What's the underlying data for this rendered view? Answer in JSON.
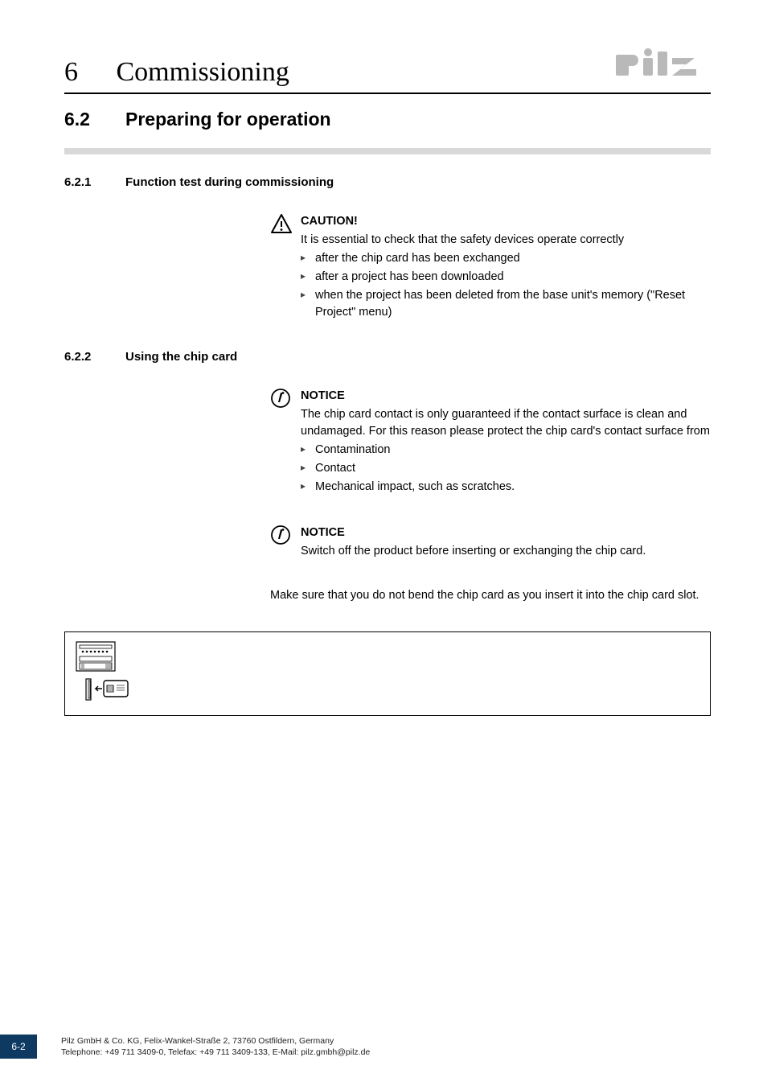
{
  "header": {
    "chapter_number": "6",
    "chapter_title": "Commissioning"
  },
  "h2": {
    "num": "6.2",
    "title": "Preparing for operation"
  },
  "sections": {
    "s1": {
      "num": "6.2.1",
      "title": "Function test during commissioning",
      "caution_label": "CAUTION!",
      "caution_intro": "It is essential to check that the safety devices operate correctly",
      "caution_items": {
        "a": "after the chip card has been exchanged",
        "b": "after a project has been downloaded",
        "c": "when the project has been deleted from the base unit's memory (\"Reset Project\" menu)"
      }
    },
    "s2": {
      "num": "6.2.2",
      "title": "Using the chip card",
      "notice1_label": "NOTICE",
      "notice1_text": "The chip card contact is only guaranteed if the contact surface is clean and undamaged. For this reason please protect the chip card's contact surface from",
      "notice1_items": {
        "a": "Contamination",
        "b": "Contact",
        "c": "Mechanical impact, such as scratches."
      },
      "notice2_label": "NOTICE",
      "notice2_text": "Switch off the product before inserting or exchanging the chip card.",
      "para": "Make sure that you do not bend the chip card as you insert it into the chip card slot."
    }
  },
  "footer": {
    "page": "6-2",
    "line1": "Pilz GmbH & Co. KG, Felix-Wankel-Straße 2, 73760 Ostfildern, Germany",
    "line2": "Telephone: +49 711 3409-0, Telefax: +49 711 3409-133, E-Mail: pilz.gmbh@pilz.de"
  }
}
